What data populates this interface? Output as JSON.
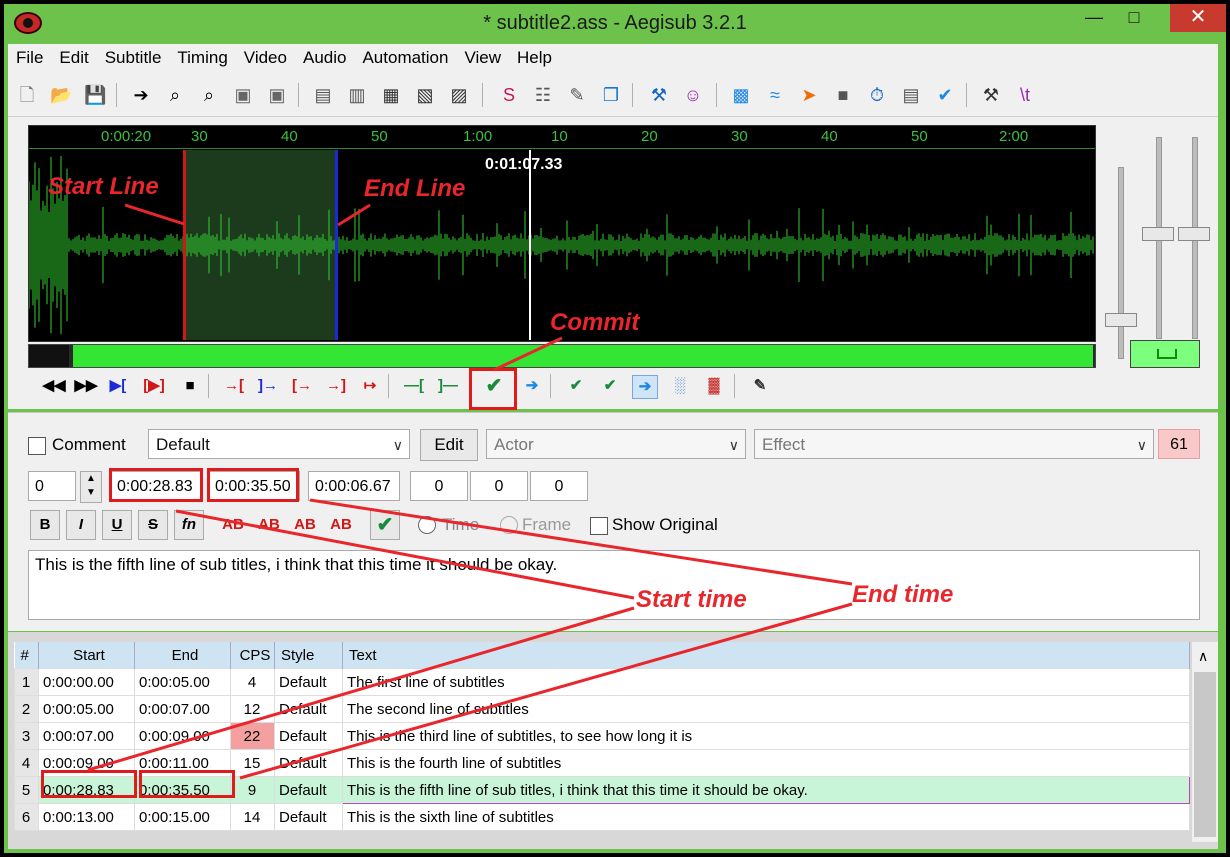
{
  "window": {
    "title": "* subtitle2.ass - Aegisub 3.2.1",
    "minimize": "—",
    "maximize": "□",
    "close": "✕"
  },
  "menu": [
    "File",
    "Edit",
    "Subtitle",
    "Timing",
    "Video",
    "Audio",
    "Automation",
    "View",
    "Help"
  ],
  "audio": {
    "ruler_ticks": [
      "0:00:20",
      "30",
      "40",
      "50",
      "1:00",
      "10",
      "20",
      "30",
      "40",
      "50",
      "2:00"
    ],
    "cursor_time": "0:01:07.33"
  },
  "edit": {
    "comment_label": "Comment",
    "style": "Default",
    "edit_button": "Edit",
    "actor_placeholder": "Actor",
    "effect_placeholder": "Effect",
    "char_count": "61",
    "layer": "0",
    "start_time": "0:00:28.83",
    "end_time": "0:00:35.50",
    "duration": "0:00:06.67",
    "margin_l": "0",
    "margin_r": "0",
    "margin_v": "0",
    "fmt_bold": "B",
    "fmt_italic": "I",
    "fmt_underline": "U",
    "fmt_strike": "S",
    "fmt_fn": "fn",
    "fmt_colors": [
      "AB",
      "AB",
      "AB",
      "AB"
    ],
    "time_label": "Time",
    "frame_label": "Frame",
    "show_original_label": "Show Original",
    "text": "This is the fifth line of sub titles, i think that this time it should be okay."
  },
  "grid": {
    "headers": [
      "#",
      "Start",
      "End",
      "CPS",
      "Style",
      "Text"
    ],
    "rows": [
      {
        "num": "1",
        "start": "0:00:00.00",
        "end": "0:00:05.00",
        "cps": "4",
        "style": "Default",
        "text": "The first line of subtitles"
      },
      {
        "num": "2",
        "start": "0:00:05.00",
        "end": "0:00:07.00",
        "cps": "12",
        "style": "Default",
        "text": "The second line of subtitles"
      },
      {
        "num": "3",
        "start": "0:00:07.00",
        "end": "0:00:09.00",
        "cps": "22",
        "style": "Default",
        "text": "This is the third line of subtitles, to see how long it is"
      },
      {
        "num": "4",
        "start": "0:00:09.00",
        "end": "0:00:11.00",
        "cps": "15",
        "style": "Default",
        "text": "This is the fourth line of subtitles"
      },
      {
        "num": "5",
        "start": "0:00:28.83",
        "end": "0:00:35.50",
        "cps": "9",
        "style": "Default",
        "text": "This is the fifth line of sub titles, i think that this time it should be okay."
      },
      {
        "num": "6",
        "start": "0:00:13.00",
        "end": "0:00:15.00",
        "cps": "14",
        "style": "Default",
        "text": "This is the sixth line of subtitles"
      }
    ]
  },
  "annotations": {
    "start_line": "Start Line",
    "end_line": "End Line",
    "commit": "Commit",
    "start_time": "Start time",
    "end_time": "End time"
  },
  "colors": {
    "chrome": "#6cc24a",
    "annotation": "#e8262b",
    "waveform": "#2fd02f"
  }
}
